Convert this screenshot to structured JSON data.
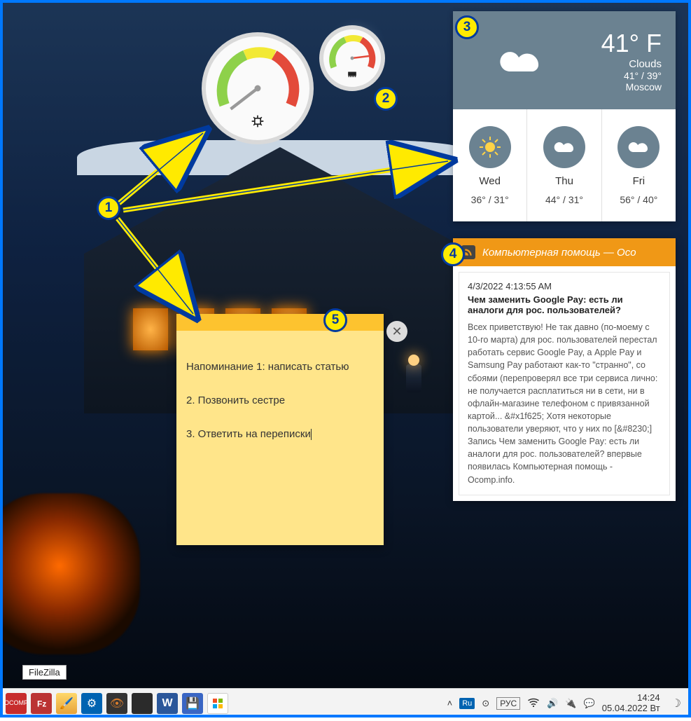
{
  "weather": {
    "temp": "41° F",
    "condition": "Clouds",
    "range": "41° / 39°",
    "location": "Moscow",
    "days": [
      {
        "name": "Wed",
        "range": "36° / 31°",
        "icon": "sun"
      },
      {
        "name": "Thu",
        "range": "44° / 31°",
        "icon": "cloud"
      },
      {
        "name": "Fri",
        "range": "56° / 40°",
        "icon": "cloud"
      }
    ]
  },
  "rss": {
    "feed_title": "Компьютерная помощь — Oco",
    "date": "4/3/2022 4:13:55 AM",
    "article_title": "Чем заменить Google Pay: есть ли аналоги для рос. пользователей?",
    "article_text": "Всех приветствую! Не так давно (по-моему с 10-го марта) для рос. пользователей перестал работать сервис Google Pay, а Apple Pay и Samsung Pay работают как-то \"странно\", со сбоями (перепроверял все три сервиса лично: не получается расплатиться ни в сети, ни в офлайн-магазине телефоном с привязанной картой... &#x1f625; Хотя некоторые пользователи уверяют, что у них по [&#8230;] Запись Чем заменить Google Pay: есть ли аналоги для рос. пользователей? впервые появилась Компьютерная помощь - Ocomp.info."
  },
  "note": {
    "line1": "Напоминание 1: написать статью",
    "line2": "2. Позвонить сестре",
    "line3": "3. Ответить на переписки"
  },
  "gauges": {
    "big_icon": "cpu-chip",
    "small_icon": "memory-chip"
  },
  "desktop_icon_tooltip": "FileZilla",
  "taskbar": {
    "apps": [
      "ocomp",
      "filezilla",
      "paint",
      "settings",
      "eye",
      "terminal",
      "word",
      "save",
      "store"
    ],
    "tray": {
      "keyboard": "Ru",
      "lang": "РУС",
      "time": "14:24",
      "date": "05.04.2022 Вт"
    }
  },
  "annotations": {
    "b1": "1",
    "b2": "2",
    "b3": "3",
    "b4": "4",
    "b5": "5"
  }
}
